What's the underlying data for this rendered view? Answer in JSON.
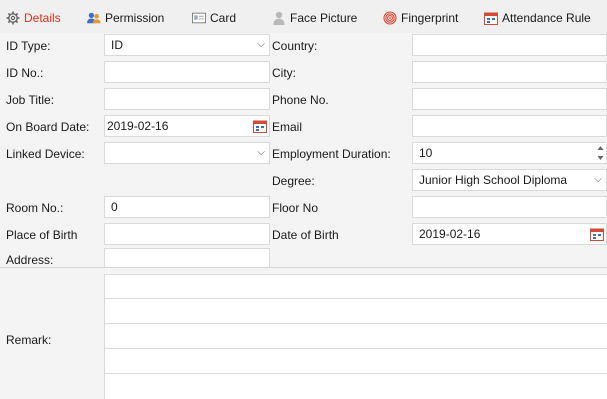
{
  "tabs": [
    {
      "label": "Details",
      "icon": "gear-icon"
    },
    {
      "label": "Permission",
      "icon": "users-icon"
    },
    {
      "label": "Card",
      "icon": "card-icon"
    },
    {
      "label": "Face Picture",
      "icon": "person-icon"
    },
    {
      "label": "Fingerprint",
      "icon": "fingerprint-icon"
    },
    {
      "label": "Attendance Rule",
      "icon": "calendar-icon"
    }
  ],
  "form": {
    "id_type": {
      "label": "ID Type:",
      "value": "ID"
    },
    "id_no": {
      "label": "ID No.:",
      "value": ""
    },
    "job_title": {
      "label": "Job Title:",
      "value": ""
    },
    "on_board_date": {
      "label": "On Board Date:",
      "value": "2019-02-16"
    },
    "linked_device": {
      "label": "Linked Device:",
      "value": ""
    },
    "room_no": {
      "label": "Room No.:",
      "value": "0"
    },
    "place_of_birth": {
      "label": "Place of Birth",
      "value": ""
    },
    "address": {
      "label": "Address:",
      "value": ""
    },
    "country": {
      "label": "Country:",
      "value": ""
    },
    "city": {
      "label": "City:",
      "value": ""
    },
    "phone_no": {
      "label": "Phone No.",
      "value": ""
    },
    "email": {
      "label": "Email",
      "value": ""
    },
    "employment_duration": {
      "label": "Employment Duration:",
      "value": "10"
    },
    "degree": {
      "label": "Degree:",
      "value": "Junior High School Diploma"
    },
    "floor_no": {
      "label": "Floor No",
      "value": ""
    },
    "date_of_birth": {
      "label": "Date of Birth",
      "value": "2019-02-16"
    },
    "remark": {
      "label": "Remark:",
      "value": ""
    }
  },
  "colors": {
    "active_tab": "#e0301e",
    "field_border": "#d9d9d9"
  }
}
